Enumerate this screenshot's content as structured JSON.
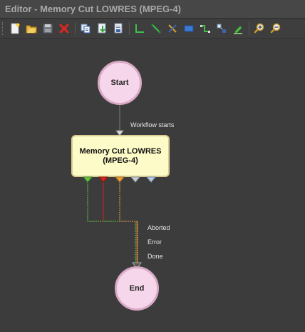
{
  "window": {
    "title": "Editor - Memory Cut LOWRES (MPEG-4)"
  },
  "toolbar": {
    "buttons": [
      {
        "name": "new",
        "icon": "new-document-icon"
      },
      {
        "name": "open",
        "icon": "folder-open-icon"
      },
      {
        "name": "save",
        "icon": "floppy-disk-icon"
      },
      {
        "name": "delete",
        "icon": "red-x-icon"
      },
      {
        "name": "copy",
        "icon": "copy-icon"
      },
      {
        "name": "import",
        "icon": "import-icon"
      },
      {
        "name": "export",
        "icon": "export-icon"
      },
      {
        "name": "connector-elbow",
        "icon": "elbow-connector-icon"
      },
      {
        "name": "connector-straight",
        "icon": "straight-connector-icon"
      },
      {
        "name": "cut-connection",
        "icon": "scissors-icon"
      },
      {
        "name": "add-box",
        "icon": "rectangle-icon"
      },
      {
        "name": "route-connector",
        "icon": "route-connector-icon"
      },
      {
        "name": "align",
        "icon": "align-icon"
      },
      {
        "name": "highlight",
        "icon": "pen-icon"
      },
      {
        "name": "zoom-in",
        "icon": "zoom-in-icon"
      },
      {
        "name": "zoom-out",
        "icon": "zoom-out-icon"
      }
    ]
  },
  "workflow": {
    "start_node": "Start",
    "end_node": "End",
    "task_node": "Memory Cut LOWRES\n(MPEG-4)",
    "start_connection_label": "Workflow starts",
    "outcomes": [
      {
        "label": "Aborted",
        "color": "#6cc24a"
      },
      {
        "label": "Error",
        "color": "#d7261e"
      },
      {
        "label": "Done",
        "color": "#e9a23b"
      }
    ],
    "extra_ports": [
      {
        "color": "#c7cdd3"
      },
      {
        "color": "#b9cbe0"
      }
    ]
  },
  "colors": {
    "background": "#3c3c3c",
    "circle_fill": "#f6d6ea",
    "task_fill": "#fdfbc8"
  }
}
